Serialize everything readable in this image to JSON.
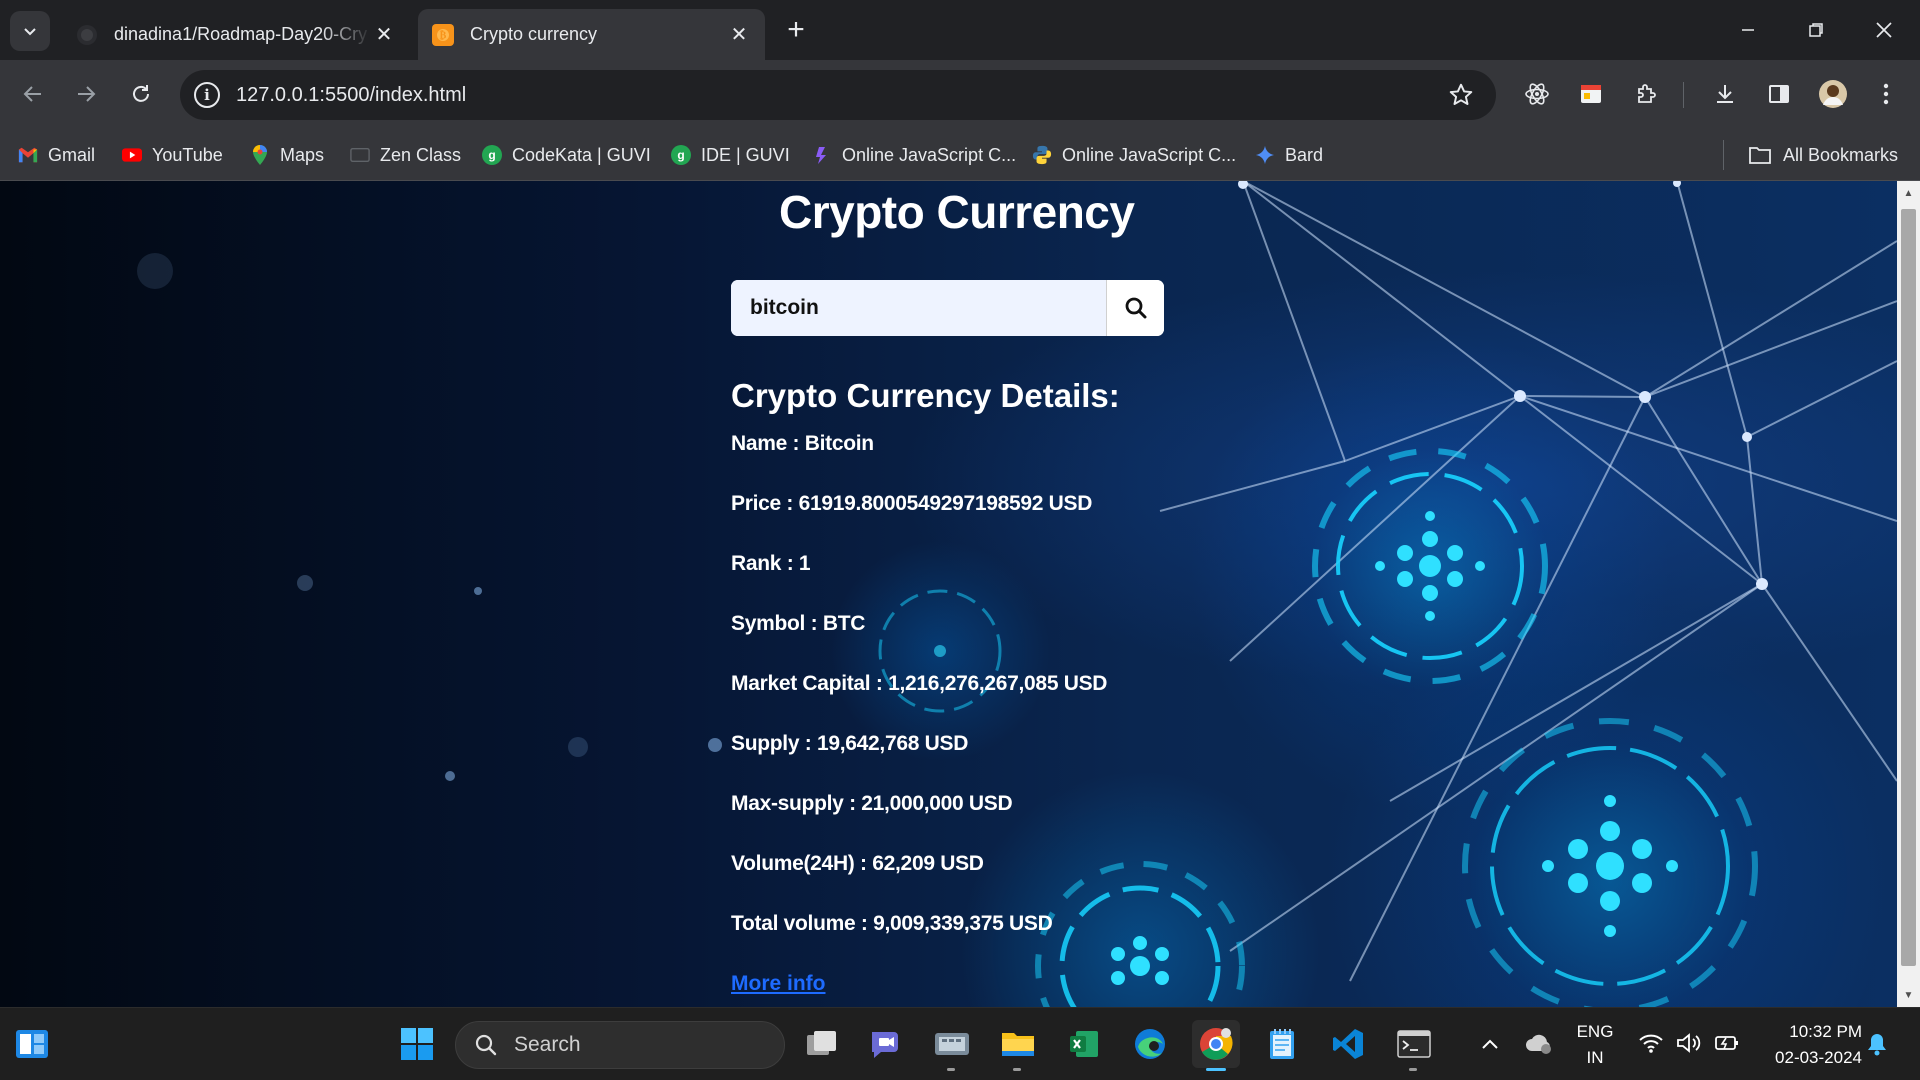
{
  "browser": {
    "tabs": [
      {
        "title": "dinadina1/Roadmap-Day20-Cry",
        "active": false
      },
      {
        "title": "Crypto currency",
        "active": true
      }
    ],
    "url": "127.0.0.1:5500/index.html",
    "bookmarks": [
      {
        "label": "Gmail",
        "icon": "gmail-icon"
      },
      {
        "label": "YouTube",
        "icon": "youtube-icon"
      },
      {
        "label": "Maps",
        "icon": "maps-icon"
      },
      {
        "label": "Zen Class",
        "icon": "zen-class-icon"
      },
      {
        "label": "CodeKata | GUVI",
        "icon": "guvi-icon"
      },
      {
        "label": "IDE | GUVI",
        "icon": "guvi-icon"
      },
      {
        "label": "Online JavaScript C...",
        "icon": "js-compiler-icon"
      },
      {
        "label": "Online JavaScript C...",
        "icon": "python-icon"
      },
      {
        "label": "Bard",
        "icon": "bard-icon"
      }
    ],
    "all_bookmarks_label": "All Bookmarks"
  },
  "page": {
    "title": "Crypto Currency",
    "search_value": "bitcoin",
    "details_heading": "Crypto Currency Details:",
    "details": [
      {
        "label": "Name",
        "value": "Bitcoin"
      },
      {
        "label": "Price",
        "value": "61919.8000549297198592 USD"
      },
      {
        "label": "Rank",
        "value": "1"
      },
      {
        "label": "Symbol",
        "value": "BTC"
      },
      {
        "label": "Market Capital",
        "value": "1,216,276,267,085 USD"
      },
      {
        "label": "Supply",
        "value": "19,642,768 USD"
      },
      {
        "label": "Max-supply",
        "value": "21,000,000 USD"
      },
      {
        "label": "Volume(24H)",
        "value": "62,209 USD"
      },
      {
        "label": "Total volume",
        "value": "9,009,339,375 USD"
      }
    ],
    "more_info": "More info"
  },
  "taskbar": {
    "search_label": "Search",
    "language": "ENG",
    "region": "IN",
    "time": "10:32 PM",
    "date": "02-03-2024"
  },
  "colors": {
    "accent": "#4cc2ff",
    "link": "#1e6bff",
    "glow": "#00c8ff"
  }
}
